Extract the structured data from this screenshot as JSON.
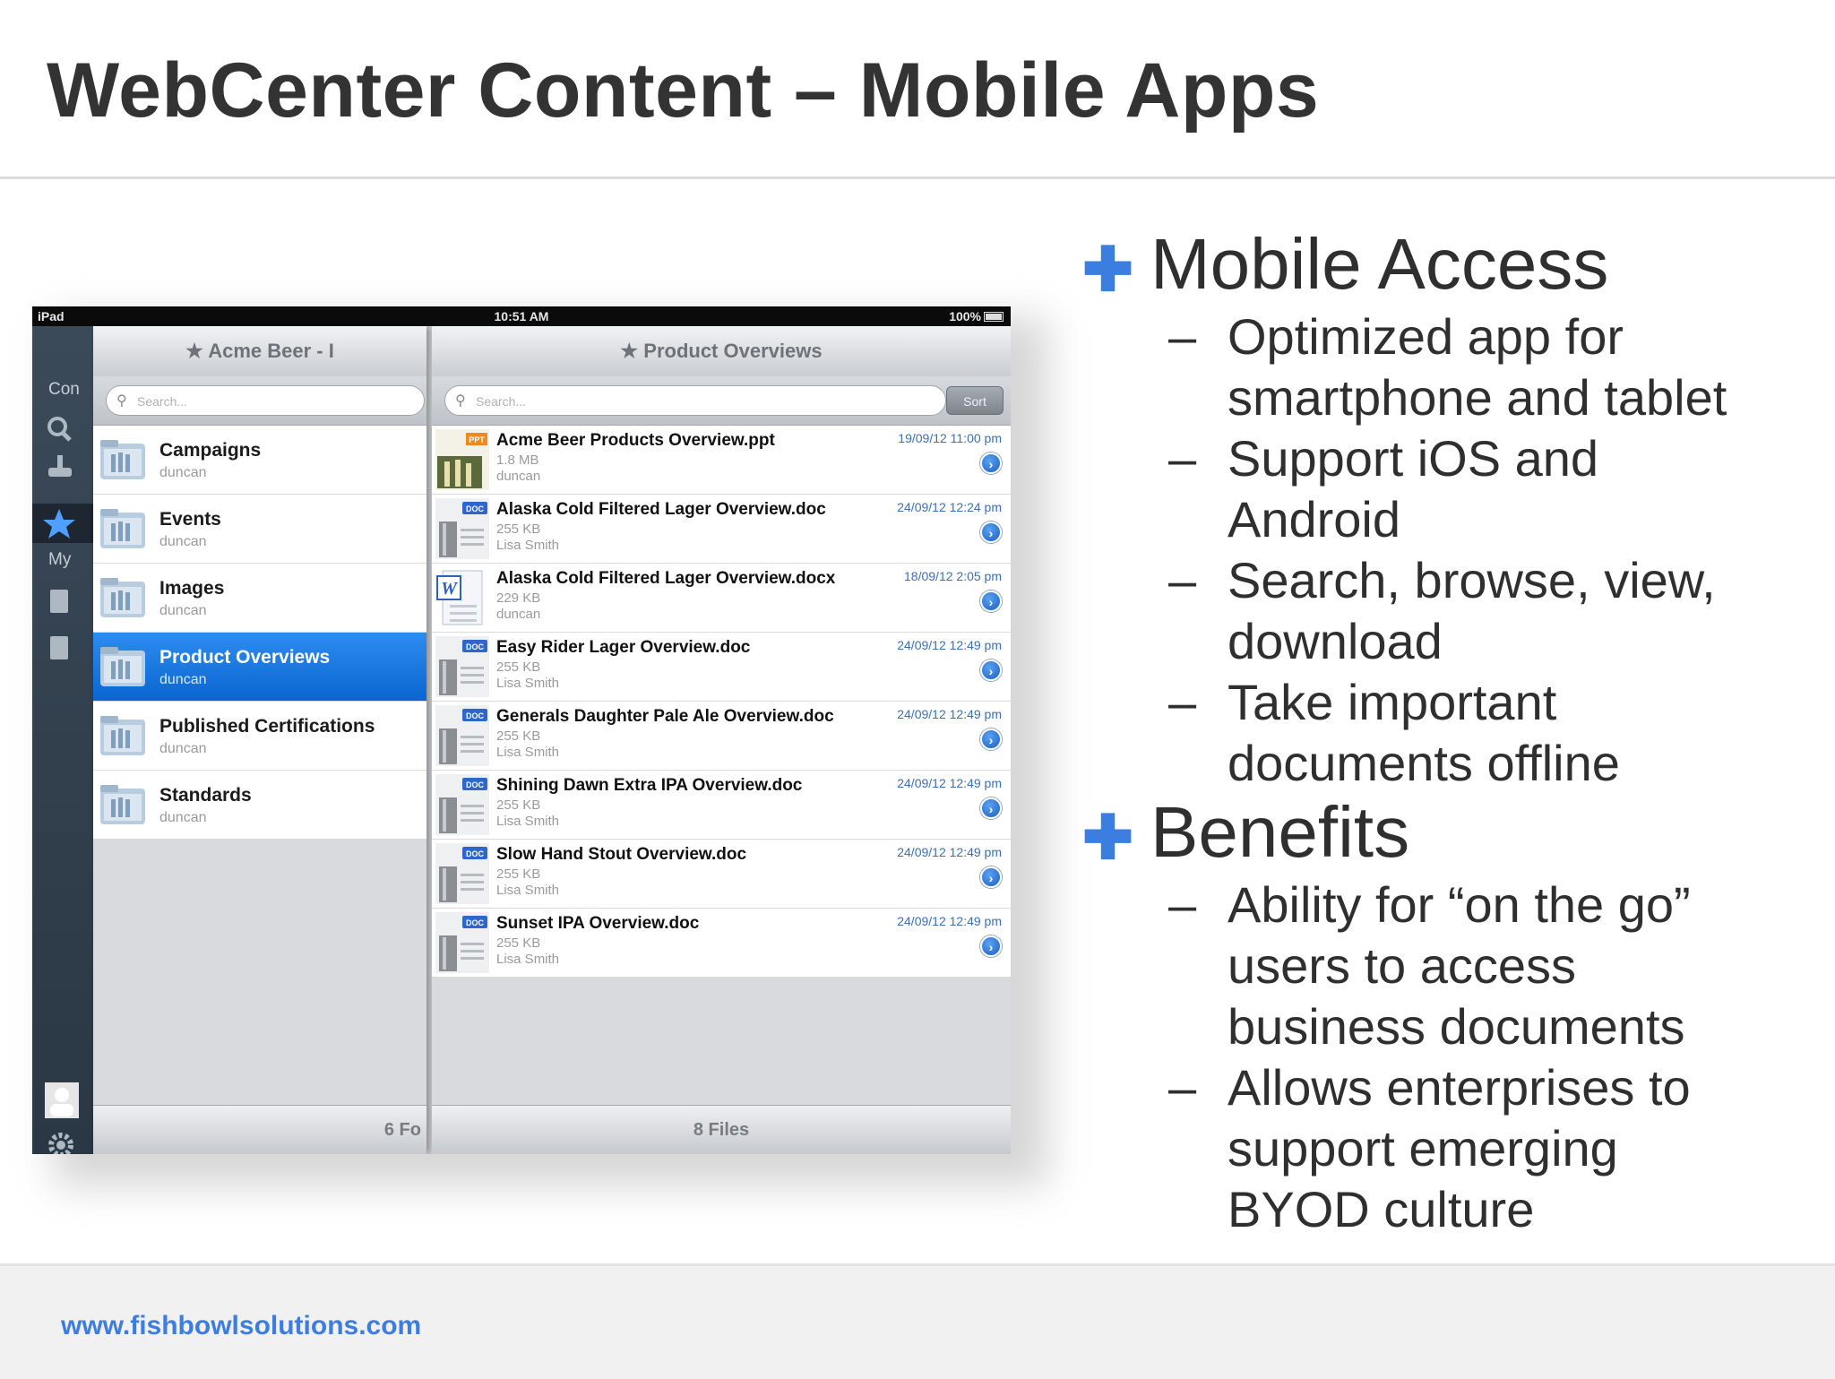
{
  "slide": {
    "title": "WebCenter Content – Mobile Apps",
    "footer_url": "www.fishbowlsolutions.com"
  },
  "ipad": {
    "status": {
      "left": "iPad",
      "time": "10:51 AM",
      "battery": "100%"
    },
    "rail": {
      "label_top": "Con",
      "label_mid": "My"
    },
    "left_pane": {
      "title": "Acme Beer - I",
      "search_placeholder": "Search...",
      "folders": [
        {
          "name": "Campaigns",
          "owner": "duncan",
          "selected": false
        },
        {
          "name": "Events",
          "owner": "duncan",
          "selected": false
        },
        {
          "name": "Images",
          "owner": "duncan",
          "selected": false
        },
        {
          "name": "Product Overviews",
          "owner": "duncan",
          "selected": true
        },
        {
          "name": "Published Certifications",
          "owner": "duncan",
          "selected": false
        },
        {
          "name": "Standards",
          "owner": "duncan",
          "selected": false
        }
      ],
      "footer": "6 Fo"
    },
    "right_pane": {
      "title": "Product Overviews",
      "search_placeholder": "Search...",
      "sort_label": "Sort",
      "files": [
        {
          "name": "Acme Beer Products Overview.ppt",
          "size": "1.8 MB",
          "owner": "duncan",
          "date": "19/09/12 11:00 pm",
          "badge": "PPT",
          "kind": "ppt"
        },
        {
          "name": "Alaska Cold Filtered Lager Overview.doc",
          "size": "255 KB",
          "owner": "Lisa Smith",
          "date": "24/09/12 12:24 pm",
          "badge": "DOC",
          "kind": "doc"
        },
        {
          "name": "Alaska Cold Filtered Lager Overview.docx",
          "size": "229 KB",
          "owner": "duncan",
          "date": "18/09/12 2:05 pm",
          "badge": "W",
          "kind": "docx"
        },
        {
          "name": "Easy Rider Lager Overview.doc",
          "size": "255 KB",
          "owner": "Lisa Smith",
          "date": "24/09/12 12:49 pm",
          "badge": "DOC",
          "kind": "doc"
        },
        {
          "name": "Generals Daughter Pale Ale Overview.doc",
          "size": "255 KB",
          "owner": "Lisa Smith",
          "date": "24/09/12 12:49 pm",
          "badge": "DOC",
          "kind": "doc"
        },
        {
          "name": "Shining Dawn Extra IPA Overview.doc",
          "size": "255 KB",
          "owner": "Lisa Smith",
          "date": "24/09/12 12:49 pm",
          "badge": "DOC",
          "kind": "doc"
        },
        {
          "name": "Slow Hand Stout Overview.doc",
          "size": "255 KB",
          "owner": "Lisa Smith",
          "date": "24/09/12 12:49 pm",
          "badge": "DOC",
          "kind": "doc"
        },
        {
          "name": "Sunset IPA Overview.doc",
          "size": "255 KB",
          "owner": "Lisa Smith",
          "date": "24/09/12 12:49 pm",
          "badge": "DOC",
          "kind": "doc"
        }
      ],
      "footer": "8 Files"
    }
  },
  "bullets": [
    {
      "heading": "Mobile Access",
      "items": [
        [
          "Optimized app for",
          "smartphone and tablet"
        ],
        [
          "Support iOS and",
          "Android"
        ],
        [
          "Search, browse, view,",
          "download"
        ],
        [
          "Take important",
          "documents offline"
        ]
      ]
    },
    {
      "heading": "Benefits",
      "items": [
        [
          "Ability for “on the go”",
          "users to access",
          "business documents"
        ],
        [
          "Allows enterprises to",
          "support emerging",
          "BYOD culture"
        ]
      ]
    }
  ],
  "colors": {
    "accent": "#3c7de0",
    "title": "#333333",
    "selection": "#1a78e6"
  },
  "icons": [
    "star-icon",
    "search-icon",
    "folder-icon",
    "disclosure-icon",
    "settings-icon",
    "user-icon",
    "plus-bullet-icon"
  ]
}
